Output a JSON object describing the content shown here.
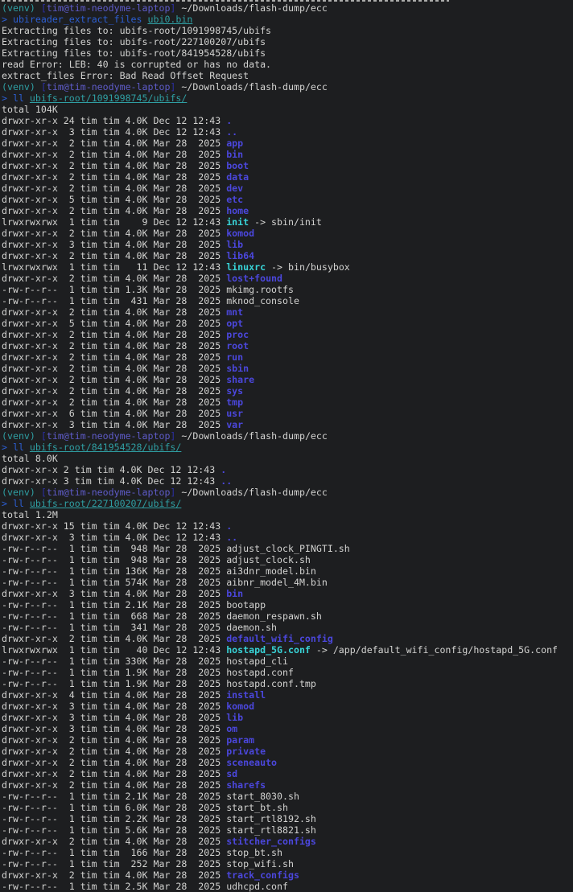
{
  "terminal": {
    "colors": {
      "background": "#1d1e20",
      "foreground": "#d3d3d1",
      "venv_teal": "#2f9fa3",
      "bracket_blue": "#2b2fa5",
      "host_violet": "#5e5bc8",
      "command_blue": "#2c5ed2",
      "directory_blue": "#4b47dc",
      "symlink_cyan": "#38d3d7"
    },
    "working_directory": "~/Downloads/flash-dump/ecc",
    "user_host": "tim@tim-neodyme-laptop",
    "venv_name": "(venv)",
    "lines": [
      {
        "spans": [
          [
            "venv",
            "(venv)"
          ],
          [
            "fg",
            " "
          ],
          [
            "bracket",
            "["
          ],
          [
            "host",
            "tim@tim-neodyme-laptop"
          ],
          [
            "bracket",
            "]"
          ],
          [
            "fg",
            " ~/Downloads/flash-dump/ecc"
          ]
        ]
      },
      {
        "spans": [
          [
            "prompt",
            "> "
          ],
          [
            "cmd",
            "ubireader_extract_files"
          ],
          [
            "fg",
            " "
          ],
          [
            "arglink",
            "ubi0.bin"
          ]
        ]
      },
      {
        "spans": [
          [
            "fg",
            "Extracting files to: ubifs-root/1091998745/ubifs"
          ]
        ]
      },
      {
        "spans": [
          [
            "fg",
            "Extracting files to: ubifs-root/227100207/ubifs"
          ]
        ]
      },
      {
        "spans": [
          [
            "fg",
            "Extracting files to: ubifs-root/841954528/ubifs"
          ]
        ]
      },
      {
        "spans": [
          [
            "fg",
            "read Error: LEB: 40 is corrupted or has no data."
          ]
        ]
      },
      {
        "spans": [
          [
            "fg",
            "extract_files Error: Bad Read Offset Request"
          ]
        ]
      },
      {
        "spans": [
          [
            "venv",
            "(venv)"
          ],
          [
            "fg",
            " "
          ],
          [
            "bracket",
            "["
          ],
          [
            "host",
            "tim@tim-neodyme-laptop"
          ],
          [
            "bracket",
            "]"
          ],
          [
            "fg",
            " ~/Downloads/flash-dump/ecc"
          ]
        ]
      },
      {
        "spans": [
          [
            "prompt",
            "> "
          ],
          [
            "cmd",
            "ll"
          ],
          [
            "fg",
            " "
          ],
          [
            "arglink",
            "ubifs-root/1091998745/ubifs/"
          ]
        ]
      },
      {
        "spans": [
          [
            "fg",
            "total 104K"
          ]
        ]
      },
      {
        "spans": [
          [
            "fg",
            "drwxr-xr-x 24 tim tim 4.0K Dec 12 12:43 "
          ],
          [
            "dir",
            "."
          ]
        ]
      },
      {
        "spans": [
          [
            "fg",
            "drwxr-xr-x  3 tim tim 4.0K Dec 12 12:43 "
          ],
          [
            "dir",
            ".."
          ]
        ]
      },
      {
        "spans": [
          [
            "fg",
            "drwxr-xr-x  2 tim tim 4.0K Mar 28  2025 "
          ],
          [
            "dir",
            "app"
          ]
        ]
      },
      {
        "spans": [
          [
            "fg",
            "drwxr-xr-x  2 tim tim 4.0K Mar 28  2025 "
          ],
          [
            "dir",
            "bin"
          ]
        ]
      },
      {
        "spans": [
          [
            "fg",
            "drwxr-xr-x  2 tim tim 4.0K Mar 28  2025 "
          ],
          [
            "dir",
            "boot"
          ]
        ]
      },
      {
        "spans": [
          [
            "fg",
            "drwxr-xr-x  2 tim tim 4.0K Mar 28  2025 "
          ],
          [
            "dir",
            "data"
          ]
        ]
      },
      {
        "spans": [
          [
            "fg",
            "drwxr-xr-x  2 tim tim 4.0K Mar 28  2025 "
          ],
          [
            "dir",
            "dev"
          ]
        ]
      },
      {
        "spans": [
          [
            "fg",
            "drwxr-xr-x  5 tim tim 4.0K Mar 28  2025 "
          ],
          [
            "dir",
            "etc"
          ]
        ]
      },
      {
        "spans": [
          [
            "fg",
            "drwxr-xr-x  2 tim tim 4.0K Mar 28  2025 "
          ],
          [
            "dir",
            "home"
          ]
        ]
      },
      {
        "spans": [
          [
            "fg",
            "lrwxrwxrwx  1 tim tim    9 Dec 12 12:43 "
          ],
          [
            "symlink",
            "init"
          ],
          [
            "fg",
            " -> sbin/init"
          ]
        ]
      },
      {
        "spans": [
          [
            "fg",
            "drwxr-xr-x  2 tim tim 4.0K Mar 28  2025 "
          ],
          [
            "dir",
            "komod"
          ]
        ]
      },
      {
        "spans": [
          [
            "fg",
            "drwxr-xr-x  3 tim tim 4.0K Mar 28  2025 "
          ],
          [
            "dir",
            "lib"
          ]
        ]
      },
      {
        "spans": [
          [
            "fg",
            "drwxr-xr-x  2 tim tim 4.0K Mar 28  2025 "
          ],
          [
            "dir",
            "lib64"
          ]
        ]
      },
      {
        "spans": [
          [
            "fg",
            "lrwxrwxrwx  1 tim tim   11 Dec 12 12:43 "
          ],
          [
            "symlink",
            "linuxrc"
          ],
          [
            "fg",
            " -> bin/busybox"
          ]
        ]
      },
      {
        "spans": [
          [
            "fg",
            "drwxr-xr-x  2 tim tim 4.0K Mar 28  2025 "
          ],
          [
            "dir",
            "lost+found"
          ]
        ]
      },
      {
        "spans": [
          [
            "fg",
            "-rw-r--r--  1 tim tim 1.3K Mar 28  2025 mkimg.rootfs"
          ]
        ]
      },
      {
        "spans": [
          [
            "fg",
            "-rw-r--r--  1 tim tim  431 Mar 28  2025 mknod_console"
          ]
        ]
      },
      {
        "spans": [
          [
            "fg",
            "drwxr-xr-x  2 tim tim 4.0K Mar 28  2025 "
          ],
          [
            "dir",
            "mnt"
          ]
        ]
      },
      {
        "spans": [
          [
            "fg",
            "drwxr-xr-x  5 tim tim 4.0K Mar 28  2025 "
          ],
          [
            "dir",
            "opt"
          ]
        ]
      },
      {
        "spans": [
          [
            "fg",
            "drwxr-xr-x  2 tim tim 4.0K Mar 28  2025 "
          ],
          [
            "dir",
            "proc"
          ]
        ]
      },
      {
        "spans": [
          [
            "fg",
            "drwxr-xr-x  2 tim tim 4.0K Mar 28  2025 "
          ],
          [
            "dir",
            "root"
          ]
        ]
      },
      {
        "spans": [
          [
            "fg",
            "drwxr-xr-x  2 tim tim 4.0K Mar 28  2025 "
          ],
          [
            "dir",
            "run"
          ]
        ]
      },
      {
        "spans": [
          [
            "fg",
            "drwxr-xr-x  2 tim tim 4.0K Mar 28  2025 "
          ],
          [
            "dir",
            "sbin"
          ]
        ]
      },
      {
        "spans": [
          [
            "fg",
            "drwxr-xr-x  2 tim tim 4.0K Mar 28  2025 "
          ],
          [
            "dir",
            "share"
          ]
        ]
      },
      {
        "spans": [
          [
            "fg",
            "drwxr-xr-x  2 tim tim 4.0K Mar 28  2025 "
          ],
          [
            "dir",
            "sys"
          ]
        ]
      },
      {
        "spans": [
          [
            "fg",
            "drwxr-xr-x  2 tim tim 4.0K Mar 28  2025 "
          ],
          [
            "dir",
            "tmp"
          ]
        ]
      },
      {
        "spans": [
          [
            "fg",
            "drwxr-xr-x  6 tim tim 4.0K Mar 28  2025 "
          ],
          [
            "dir",
            "usr"
          ]
        ]
      },
      {
        "spans": [
          [
            "fg",
            "drwxr-xr-x  3 tim tim 4.0K Mar 28  2025 "
          ],
          [
            "dir",
            "var"
          ]
        ]
      },
      {
        "spans": [
          [
            "venv",
            "(venv)"
          ],
          [
            "fg",
            " "
          ],
          [
            "bracket",
            "["
          ],
          [
            "host",
            "tim@tim-neodyme-laptop"
          ],
          [
            "bracket",
            "]"
          ],
          [
            "fg",
            " ~/Downloads/flash-dump/ecc"
          ]
        ]
      },
      {
        "spans": [
          [
            "prompt",
            "> "
          ],
          [
            "cmd",
            "ll"
          ],
          [
            "fg",
            " "
          ],
          [
            "arglink",
            "ubifs-root/841954528/ubifs/"
          ]
        ]
      },
      {
        "spans": [
          [
            "fg",
            "total 8.0K"
          ]
        ]
      },
      {
        "spans": [
          [
            "fg",
            "drwxr-xr-x 2 tim tim 4.0K Dec 12 12:43 "
          ],
          [
            "dir",
            "."
          ]
        ]
      },
      {
        "spans": [
          [
            "fg",
            "drwxr-xr-x 3 tim tim 4.0K Dec 12 12:43 "
          ],
          [
            "dir",
            ".."
          ]
        ]
      },
      {
        "spans": [
          [
            "venv",
            "(venv)"
          ],
          [
            "fg",
            " "
          ],
          [
            "bracket",
            "["
          ],
          [
            "host",
            "tim@tim-neodyme-laptop"
          ],
          [
            "bracket",
            "]"
          ],
          [
            "fg",
            " ~/Downloads/flash-dump/ecc"
          ]
        ]
      },
      {
        "spans": [
          [
            "prompt",
            "> "
          ],
          [
            "cmd",
            "ll"
          ],
          [
            "fg",
            " "
          ],
          [
            "arglink",
            "ubifs-root/227100207/ubifs/"
          ]
        ]
      },
      {
        "spans": [
          [
            "fg",
            "total 1.2M"
          ]
        ]
      },
      {
        "spans": [
          [
            "fg",
            "drwxr-xr-x 15 tim tim 4.0K Dec 12 12:43 "
          ],
          [
            "dir",
            "."
          ]
        ]
      },
      {
        "spans": [
          [
            "fg",
            "drwxr-xr-x  3 tim tim 4.0K Dec 12 12:43 "
          ],
          [
            "dir",
            ".."
          ]
        ]
      },
      {
        "spans": [
          [
            "fg",
            "-rw-r--r--  1 tim tim  948 Mar 28  2025 adjust_clock_PINGTI.sh"
          ]
        ]
      },
      {
        "spans": [
          [
            "fg",
            "-rw-r--r--  1 tim tim  948 Mar 28  2025 adjust_clock.sh"
          ]
        ]
      },
      {
        "spans": [
          [
            "fg",
            "-rw-r--r--  1 tim tim 136K Mar 28  2025 ai3dnr_model.bin"
          ]
        ]
      },
      {
        "spans": [
          [
            "fg",
            "-rw-r--r--  1 tim tim 574K Mar 28  2025 aibnr_model_4M.bin"
          ]
        ]
      },
      {
        "spans": [
          [
            "fg",
            "drwxr-xr-x  3 tim tim 4.0K Mar 28  2025 "
          ],
          [
            "dir",
            "bin"
          ]
        ]
      },
      {
        "spans": [
          [
            "fg",
            "-rw-r--r--  1 tim tim 2.1K Mar 28  2025 bootapp"
          ]
        ]
      },
      {
        "spans": [
          [
            "fg",
            "-rw-r--r--  1 tim tim  668 Mar 28  2025 daemon_respawn.sh"
          ]
        ]
      },
      {
        "spans": [
          [
            "fg",
            "-rw-r--r--  1 tim tim  341 Mar 28  2025 daemon.sh"
          ]
        ]
      },
      {
        "spans": [
          [
            "fg",
            "drwxr-xr-x  2 tim tim 4.0K Mar 28  2025 "
          ],
          [
            "dir",
            "default_wifi_config"
          ]
        ]
      },
      {
        "spans": [
          [
            "fg",
            "lrwxrwxrwx  1 tim tim   40 Dec 12 12:43 "
          ],
          [
            "symlink",
            "hostapd_5G.conf"
          ],
          [
            "fg",
            " -> /app/default_wifi_config/hostapd_5G.conf"
          ]
        ]
      },
      {
        "spans": [
          [
            "fg",
            "-rw-r--r--  1 tim tim 330K Mar 28  2025 hostapd_cli"
          ]
        ]
      },
      {
        "spans": [
          [
            "fg",
            "-rw-r--r--  1 tim tim 1.9K Mar 28  2025 hostapd.conf"
          ]
        ]
      },
      {
        "spans": [
          [
            "fg",
            "-rw-r--r--  1 tim tim 1.9K Mar 28  2025 hostapd.conf.tmp"
          ]
        ]
      },
      {
        "spans": [
          [
            "fg",
            "drwxr-xr-x  4 tim tim 4.0K Mar 28  2025 "
          ],
          [
            "dir",
            "install"
          ]
        ]
      },
      {
        "spans": [
          [
            "fg",
            "drwxr-xr-x  3 tim tim 4.0K Mar 28  2025 "
          ],
          [
            "dir",
            "komod"
          ]
        ]
      },
      {
        "spans": [
          [
            "fg",
            "drwxr-xr-x  3 tim tim 4.0K Mar 28  2025 "
          ],
          [
            "dir",
            "lib"
          ]
        ]
      },
      {
        "spans": [
          [
            "fg",
            "drwxr-xr-x  3 tim tim 4.0K Mar 28  2025 "
          ],
          [
            "dir",
            "om"
          ]
        ]
      },
      {
        "spans": [
          [
            "fg",
            "drwxr-xr-x  2 tim tim 4.0K Mar 28  2025 "
          ],
          [
            "dir",
            "param"
          ]
        ]
      },
      {
        "spans": [
          [
            "fg",
            "drwxr-xr-x  2 tim tim 4.0K Mar 28  2025 "
          ],
          [
            "dir",
            "private"
          ]
        ]
      },
      {
        "spans": [
          [
            "fg",
            "drwxr-xr-x  2 tim tim 4.0K Mar 28  2025 "
          ],
          [
            "dir",
            "sceneauto"
          ]
        ]
      },
      {
        "spans": [
          [
            "fg",
            "drwxr-xr-x  2 tim tim 4.0K Mar 28  2025 "
          ],
          [
            "dir",
            "sd"
          ]
        ]
      },
      {
        "spans": [
          [
            "fg",
            "drwxr-xr-x  2 tim tim 4.0K Mar 28  2025 "
          ],
          [
            "dir",
            "sharefs"
          ]
        ]
      },
      {
        "spans": [
          [
            "fg",
            "-rw-r--r--  1 tim tim 2.1K Mar 28  2025 start_8030.sh"
          ]
        ]
      },
      {
        "spans": [
          [
            "fg",
            "-rw-r--r--  1 tim tim 6.0K Mar 28  2025 start_bt.sh"
          ]
        ]
      },
      {
        "spans": [
          [
            "fg",
            "-rw-r--r--  1 tim tim 2.2K Mar 28  2025 start_rtl8192.sh"
          ]
        ]
      },
      {
        "spans": [
          [
            "fg",
            "-rw-r--r--  1 tim tim 5.6K Mar 28  2025 start_rtl8821.sh"
          ]
        ]
      },
      {
        "spans": [
          [
            "fg",
            "drwxr-xr-x  2 tim tim 4.0K Mar 28  2025 "
          ],
          [
            "dir",
            "stitcher_configs"
          ]
        ]
      },
      {
        "spans": [
          [
            "fg",
            "-rw-r--r--  1 tim tim  166 Mar 28  2025 stop_bt.sh"
          ]
        ]
      },
      {
        "spans": [
          [
            "fg",
            "-rw-r--r--  1 tim tim  252 Mar 28  2025 stop_wifi.sh"
          ]
        ]
      },
      {
        "spans": [
          [
            "fg",
            "drwxr-xr-x  2 tim tim 4.0K Mar 28  2025 "
          ],
          [
            "dir",
            "track_configs"
          ]
        ]
      },
      {
        "spans": [
          [
            "fg",
            "-rw-r--r--  1 tim tim 2.5K Mar 28  2025 udhcpd.conf"
          ]
        ]
      }
    ]
  }
}
